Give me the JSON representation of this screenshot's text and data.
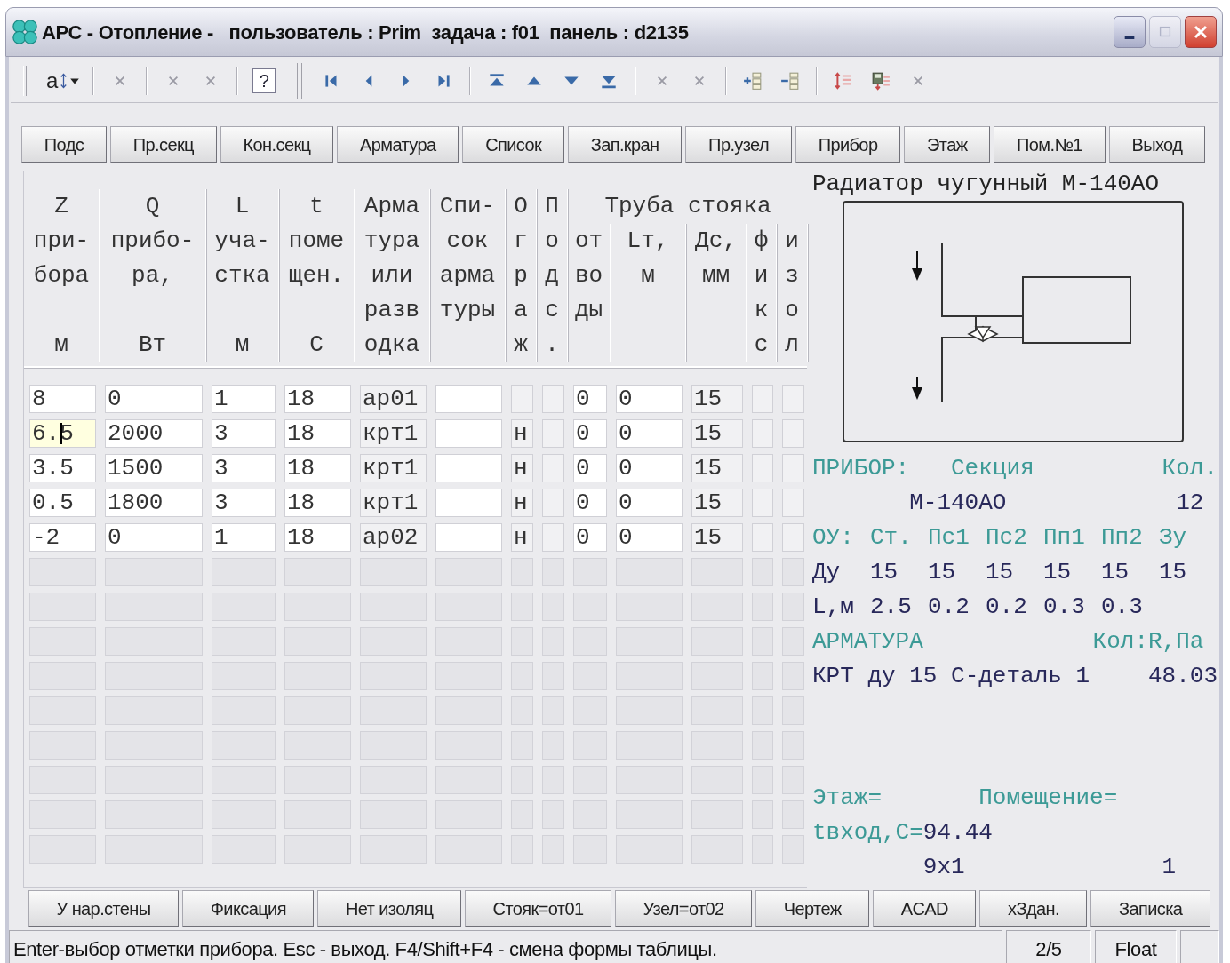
{
  "window": {
    "title": "АРС - Отопление -   пользователь : Prim  задача : f01  панель : d2135"
  },
  "toolbar": [
    {
      "kind": "sort",
      "label": "a"
    },
    {
      "kind": "separator"
    },
    {
      "kind": "cross"
    },
    {
      "kind": "separator"
    },
    {
      "kind": "cross"
    },
    {
      "kind": "cross"
    },
    {
      "kind": "separator"
    },
    {
      "kind": "help",
      "label": "?"
    },
    {
      "kind": "group_break"
    },
    {
      "kind": "first"
    },
    {
      "kind": "prev"
    },
    {
      "kind": "next"
    },
    {
      "kind": "last"
    },
    {
      "kind": "separator"
    },
    {
      "kind": "top"
    },
    {
      "kind": "up"
    },
    {
      "kind": "down"
    },
    {
      "kind": "bottom"
    },
    {
      "kind": "separator"
    },
    {
      "kind": "cross"
    },
    {
      "kind": "cross"
    },
    {
      "kind": "separator"
    },
    {
      "kind": "add_row"
    },
    {
      "kind": "delete_row"
    },
    {
      "kind": "separator"
    },
    {
      "kind": "swap"
    },
    {
      "kind": "save"
    },
    {
      "kind": "cross"
    }
  ],
  "top_buttons": [
    "Подс",
    "Пр.секц",
    "Кон.секц",
    "Арматура",
    "Список",
    "Зап.кран",
    "Пр.узел",
    "Прибор",
    "Этаж",
    "Пом.№1",
    "Выход"
  ],
  "table": {
    "columns": [
      {
        "lines": [
          "Z",
          "при-",
          "бора"
        ],
        "unit": "м",
        "editable": true
      },
      {
        "lines": [
          "Q",
          "прибо-",
          "ра,"
        ],
        "unit": "Вт",
        "editable": true
      },
      {
        "lines": [
          "L",
          "уча-",
          "стка"
        ],
        "unit": "м",
        "editable": true
      },
      {
        "lines": [
          "t",
          "поме",
          "щен."
        ],
        "unit": "С",
        "editable": true
      },
      {
        "lines": [
          "Арма",
          "тура",
          "или",
          "разв",
          "одка"
        ],
        "editable": false
      },
      {
        "lines": [
          "Спи-",
          "сок",
          "арма",
          "туры"
        ],
        "editable": true
      },
      {
        "lines": [
          "О",
          "г",
          "р",
          "а",
          "ж"
        ],
        "editable": false
      },
      {
        "lines": [
          "П",
          "о",
          "д",
          "с",
          "."
        ],
        "editable": false
      }
    ],
    "pipe_group": {
      "title": "Труба стояка",
      "columns": [
        {
          "lines": [
            "от",
            "во",
            "ды"
          ],
          "editable": true
        },
        {
          "lines": [
            "Lт,",
            "м"
          ],
          "editable": true
        },
        {
          "lines": [
            "Дс,",
            "мм"
          ],
          "editable": false
        },
        {
          "lines": [
            "ф",
            "и",
            "к",
            "с"
          ],
          "editable": false
        },
        {
          "lines": [
            "и",
            "з",
            "о",
            "л"
          ],
          "editable": false
        }
      ]
    },
    "rows": [
      {
        "enabled": true,
        "selected": false,
        "cells": [
          "8",
          "0",
          "1",
          "18",
          "ар01",
          null,
          null,
          null,
          "0",
          "0",
          "15",
          null,
          null
        ]
      },
      {
        "enabled": true,
        "selected": true,
        "cells": [
          "6.5",
          "2000",
          "3",
          "18",
          "крт1",
          null,
          "н",
          null,
          "0",
          "0",
          "15",
          null,
          null
        ]
      },
      {
        "enabled": true,
        "selected": false,
        "cells": [
          "3.5",
          "1500",
          "3",
          "18",
          "крт1",
          null,
          "н",
          null,
          "0",
          "0",
          "15",
          null,
          null
        ]
      },
      {
        "enabled": true,
        "selected": false,
        "cells": [
          "0.5",
          "1800",
          "3",
          "18",
          "крт1",
          null,
          "н",
          null,
          "0",
          "0",
          "15",
          null,
          null
        ]
      },
      {
        "enabled": true,
        "selected": false,
        "cells": [
          "-2",
          "0",
          "1",
          "18",
          "ар02",
          null,
          "н",
          null,
          "0",
          "0",
          "15",
          null,
          null
        ]
      },
      {
        "enabled": false,
        "selected": false,
        "cells": [
          null,
          null,
          null,
          null,
          null,
          null,
          null,
          null,
          null,
          null,
          null,
          null,
          null
        ]
      },
      {
        "enabled": false,
        "selected": false,
        "cells": [
          null,
          null,
          null,
          null,
          null,
          null,
          null,
          null,
          null,
          null,
          null,
          null,
          null
        ]
      },
      {
        "enabled": false,
        "selected": false,
        "cells": [
          null,
          null,
          null,
          null,
          null,
          null,
          null,
          null,
          null,
          null,
          null,
          null,
          null
        ]
      },
      {
        "enabled": false,
        "selected": false,
        "cells": [
          null,
          null,
          null,
          null,
          null,
          null,
          null,
          null,
          null,
          null,
          null,
          null,
          null
        ]
      },
      {
        "enabled": false,
        "selected": false,
        "cells": [
          null,
          null,
          null,
          null,
          null,
          null,
          null,
          null,
          null,
          null,
          null,
          null,
          null
        ]
      },
      {
        "enabled": false,
        "selected": false,
        "cells": [
          null,
          null,
          null,
          null,
          null,
          null,
          null,
          null,
          null,
          null,
          null,
          null,
          null
        ]
      },
      {
        "enabled": false,
        "selected": false,
        "cells": [
          null,
          null,
          null,
          null,
          null,
          null,
          null,
          null,
          null,
          null,
          null,
          null,
          null
        ]
      },
      {
        "enabled": false,
        "selected": false,
        "cells": [
          null,
          null,
          null,
          null,
          null,
          null,
          null,
          null,
          null,
          null,
          null,
          null,
          null
        ]
      },
      {
        "enabled": false,
        "selected": false,
        "cells": [
          null,
          null,
          null,
          null,
          null,
          null,
          null,
          null,
          null,
          null,
          null,
          null,
          null
        ]
      }
    ]
  },
  "info_panel": {
    "title": "Радиатор чугунный М-140АО",
    "device_header": {
      "label": "ПРИБОР:",
      "section": "Секция",
      "count_label": "Кол."
    },
    "device": {
      "model": "М-140АО",
      "count": "12"
    },
    "fittings": {
      "header": [
        "ОУ:",
        "Ст.",
        "Пс1",
        "Пс2",
        "Пп1",
        "Пп2",
        "Зу"
      ],
      "rows": [
        {
          "label": "Ду",
          "values": [
            "15",
            "15",
            "15",
            "15",
            "15",
            "15"
          ]
        },
        {
          "label": "L,м",
          "values": [
            "2.5",
            "0.2",
            "0.2",
            "0.3",
            "0.3"
          ]
        }
      ]
    },
    "armature_header": {
      "label": "АРМАТУРА",
      "value_label": "Кол:R,Па"
    },
    "armature_items": [
      {
        "name": "КРТ ду 15 С-деталь 1",
        "value": "48.03"
      }
    ],
    "floor_label": "Этаж=",
    "room_label": "Помещение=",
    "inlet_temp": {
      "label": "tвход,С=",
      "value": "94.44"
    },
    "footer": [
      "9x1",
      "1"
    ]
  },
  "bottom_buttons": [
    "У нар.стены",
    "Фиксация",
    "Нет изоляц",
    "Стояк=от01",
    "Узел=от02",
    "Чертеж",
    "ACAD",
    "хЗдан.",
    "Записка"
  ],
  "status_bar": {
    "message": "Enter-выбор отметки прибора. Esc - выход. F4/Shift+F4 - смена формы таблицы.",
    "page": "2/5",
    "mode": "Float"
  }
}
